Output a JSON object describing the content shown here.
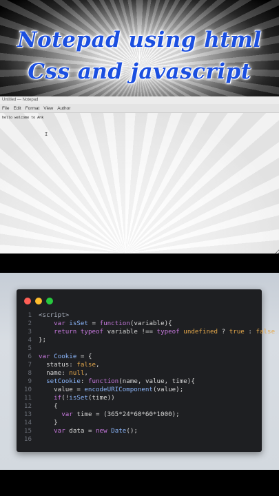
{
  "banner": {
    "line1": "Notepad  using html",
    "line2": "Css and javascript"
  },
  "notepad": {
    "title": "Untitled — Notepad",
    "menu": [
      "File",
      "Edit",
      "Format",
      "View",
      "Author"
    ],
    "text": "hello welcome to Ank",
    "cursor_glyph": "I"
  },
  "code_window": {
    "dot_colors": [
      "#ff5f56",
      "#ffbd2e",
      "#27c93f"
    ],
    "line_numbers": [
      "1",
      "2",
      "3",
      "4",
      "5",
      "6",
      "7",
      "8",
      "9",
      "10",
      "11",
      "12",
      "13",
      "14",
      "15",
      "16"
    ],
    "lines": [
      "<script>",
      "    var isSet = function(variable){",
      "    return typeof variable !== typeof undefined ? true : false;",
      "};",
      "",
      "var Cookie = {",
      "  status: false,",
      "  name: null,",
      "  setCookie: function(name, value, time){",
      "    value = encodeURIComponent(value);",
      "    if(!isSet(time))",
      "    {",
      "      var time = (365*24*60*60*1000);",
      "    }",
      "    var data = new Date();",
      ""
    ]
  }
}
